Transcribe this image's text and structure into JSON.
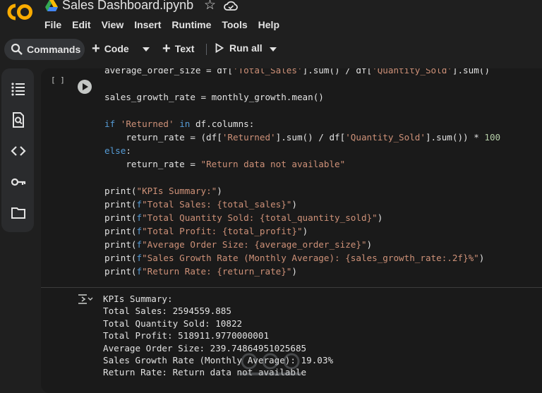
{
  "header": {
    "title": "Sales Dashboard.ipynb",
    "menu": [
      "File",
      "Edit",
      "View",
      "Insert",
      "Runtime",
      "Tools",
      "Help"
    ]
  },
  "toolbar": {
    "commands_label": "Commands",
    "code_label": "Code",
    "text_label": "Text",
    "run_all_label": "Run all"
  },
  "sidebar": {
    "icons": [
      "table-of-contents-icon",
      "find-replace-icon",
      "code-snippets-icon",
      "secrets-key-icon",
      "files-folder-icon"
    ]
  },
  "cell": {
    "execution_count": "[ ]",
    "code_lines": [
      "average_order_size = df['Total_Sales'].sum() / df['Quantity_Sold'].sum()",
      "",
      "sales_growth_rate = monthly_growth.mean()",
      "",
      "if 'Returned' in df.columns:",
      "    return_rate = (df['Returned'].sum() / df['Quantity_Sold'].sum()) * 100",
      "else:",
      "    return_rate = \"Return data not available\"",
      "",
      "print(\"KPIs Summary:\")",
      "print(f\"Total Sales: {total_sales}\")",
      "print(f\"Total Quantity Sold: {total_quantity_sold}\")",
      "print(f\"Total Profit: {total_profit}\")",
      "print(f\"Average Order Size: {average_order_size}\")",
      "print(f\"Sales Growth Rate (Monthly Average): {sales_growth_rate:.2f}%\")",
      "print(f\"Return Rate: {return_rate}\")"
    ],
    "output_lines": [
      "KPIs Summary:",
      "Total Sales: 2594559.885",
      "Total Quantity Sold: 10822",
      "Total Profit: 518911.9770000001",
      "Average Order Size: 239.74864951025685",
      "Sales Growth Rate (Monthly Average): 19.03%",
      "Return Rate: Return data not available"
    ]
  },
  "colors": {
    "background": "#1f1f1f",
    "cell_background": "#1a1a1a",
    "keyword": "#569cd6",
    "string": "#ce9178",
    "number": "#b5cea8",
    "logo_orange": "#f9ab00"
  }
}
